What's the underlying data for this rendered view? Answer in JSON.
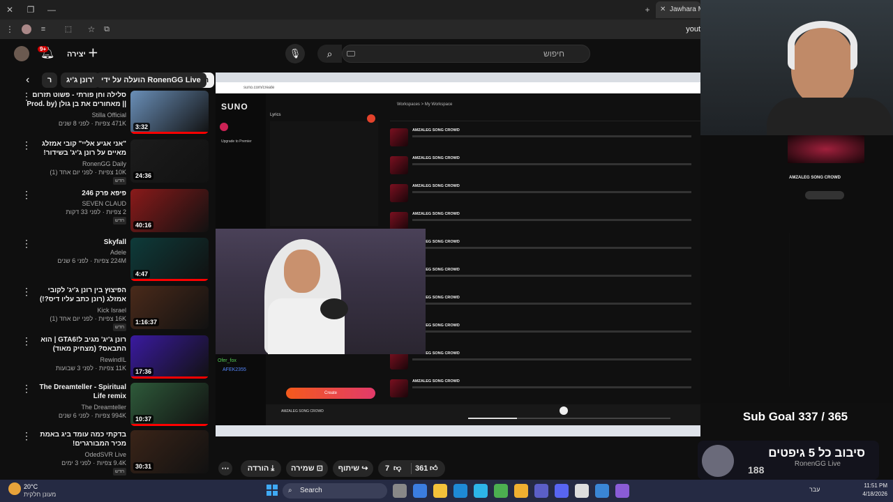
{
  "browser": {
    "active_tab_title": "Jawhara Ma",
    "address_partial": "yout"
  },
  "header": {
    "create_label": "יצירה",
    "notification_count": "9+",
    "search_placeholder": "חיפוש"
  },
  "chips": [
    "הכול",
    "הועלה על ידי RonenGG Live",
    "רונן ג'יג'",
    "ר"
  ],
  "videos": [
    {
      "title": "סלילה וחן פורתי - פשוט תזרום || מאחורים את בן גולן (Prod. by Galdi)",
      "channel": "Stilla Official",
      "meta": "471K צפיות · לפני 8 שנים",
      "duration": "3:32",
      "new": "",
      "progress": 1.0,
      "thumb": "#6a8fb8"
    },
    {
      "title": "\"אני אגיע אליי\" קובי אמזלג מאיים על רונן ג'יג' בשידור!",
      "channel": "RonenGG Daily",
      "meta": "10K צפיות · לפני יום אחד (1)",
      "duration": "24:36",
      "new": "חדש",
      "progress": 0,
      "thumb": "#1c1c1c"
    },
    {
      "title": "פיפא פרק 246",
      "channel": "SEVEN CLAUD",
      "meta": "2 צפיות · לפני 33 דקות",
      "duration": "40:16",
      "new": "חדש",
      "progress": 0,
      "thumb": "#8a1a1a"
    },
    {
      "title": "Skyfall",
      "channel": "Adele",
      "meta": "224M צפיות · לפני 6 שנים",
      "duration": "4:47",
      "new": "",
      "progress": 1.0,
      "thumb": "#0e3b3a"
    },
    {
      "title": "הפיצוץ בין רונן ג'יג' לקובי אמזלג (רונן כתב עליו דיס?!)",
      "channel": "Kick Israel",
      "meta": "16K צפיות · לפני יום אחד (1)",
      "duration": "1:16:37",
      "new": "חדש",
      "progress": 0,
      "thumb": "#4a2a1a"
    },
    {
      "title": "רונן ג'יג' מגיב ל!GTA6 | הוא התבאס? (מצחיק מאוד)",
      "channel": "RewindIL",
      "meta": "11K צפיות · לפני 3 שבועות",
      "duration": "17:36",
      "new": "",
      "progress": 1.0,
      "thumb": "#3a1aa0"
    },
    {
      "title": "The Dreamteller - Spiritual Life remix",
      "channel": "The Dreamteller",
      "meta": "994K צפיות · לפני 6 שנים",
      "duration": "10:37",
      "new": "",
      "progress": 1.0,
      "thumb": "#2e5a3a"
    },
    {
      "title": "בדקתי כמה עומד ביג באמת מכיר המבורגרים!",
      "channel": "OdedSVR Live",
      "meta": "9.4K צפיות · לפני 3 ימים",
      "duration": "30:31",
      "new": "חדש",
      "progress": 0,
      "thumb": "#3a2418"
    }
  ],
  "player": {
    "suno_logo": "SUNO",
    "workspace": "Workspaces > My Workspace",
    "song_title": "AMZALEG SONG CROWD",
    "create_button": "Create",
    "lyrics_label": "Lyrics",
    "chat_user1": "Ofer_fox",
    "chat_user2": "AFEK2355"
  },
  "overlay": {
    "sub_goal": "Sub Goal 337 / 365",
    "banner_text": "סיבוב כל 5 גיפטים",
    "banner_channel": "RonenGG Live",
    "banner_count": "188"
  },
  "actions": {
    "likes": "361",
    "dislikes": "7",
    "share": "שיתוף",
    "save": "שמירה",
    "download": "הורדה"
  },
  "taskbar": {
    "weather_temp": "20°C",
    "weather_desc": "מעונן חלקית",
    "search": "Search",
    "lang": "עבר",
    "time": "11:51 PM",
    "date": "4/18/2026"
  }
}
